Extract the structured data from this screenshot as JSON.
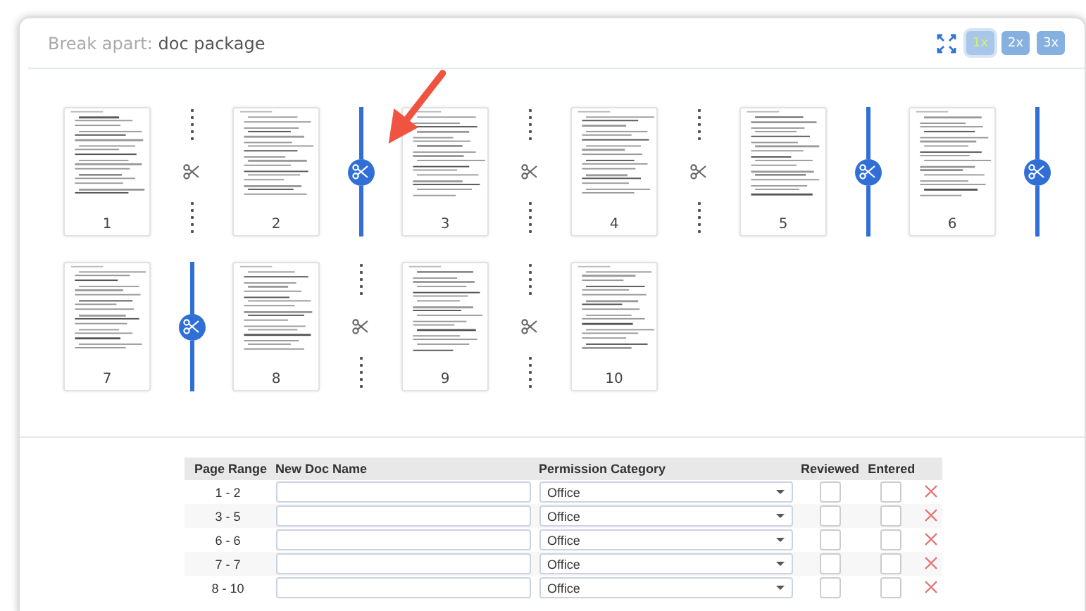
{
  "title": {
    "label": "Break apart:",
    "name": "doc package"
  },
  "zoom_buttons": [
    {
      "label": "1x",
      "selected": true
    },
    {
      "label": "2x",
      "selected": false
    },
    {
      "label": "3x",
      "selected": false
    }
  ],
  "pages": [
    {
      "number": "1",
      "split_after": false
    },
    {
      "number": "2",
      "split_after": true
    },
    {
      "number": "3",
      "split_after": false
    },
    {
      "number": "4",
      "split_after": false
    },
    {
      "number": "5",
      "split_after": true
    },
    {
      "number": "6",
      "split_after": true
    },
    {
      "number": "7",
      "split_after": true
    },
    {
      "number": "8",
      "split_after": false
    },
    {
      "number": "9",
      "split_after": false
    },
    {
      "number": "10"
    }
  ],
  "table": {
    "columns": [
      "Page Range",
      "New Doc Name",
      "Permission Category",
      "Reviewed",
      "Entered"
    ],
    "rows": [
      {
        "range": "1 - 2",
        "category": "Office",
        "reviewed": false,
        "entered": false
      },
      {
        "range": "3 - 5",
        "category": "Office",
        "reviewed": false,
        "entered": false
      },
      {
        "range": "6 - 6",
        "category": "Office",
        "reviewed": false,
        "entered": false
      },
      {
        "range": "7 - 7",
        "category": "Office",
        "reviewed": false,
        "entered": false
      },
      {
        "range": "8 - 10",
        "category": "Office",
        "reviewed": false,
        "entered": false
      }
    ]
  }
}
